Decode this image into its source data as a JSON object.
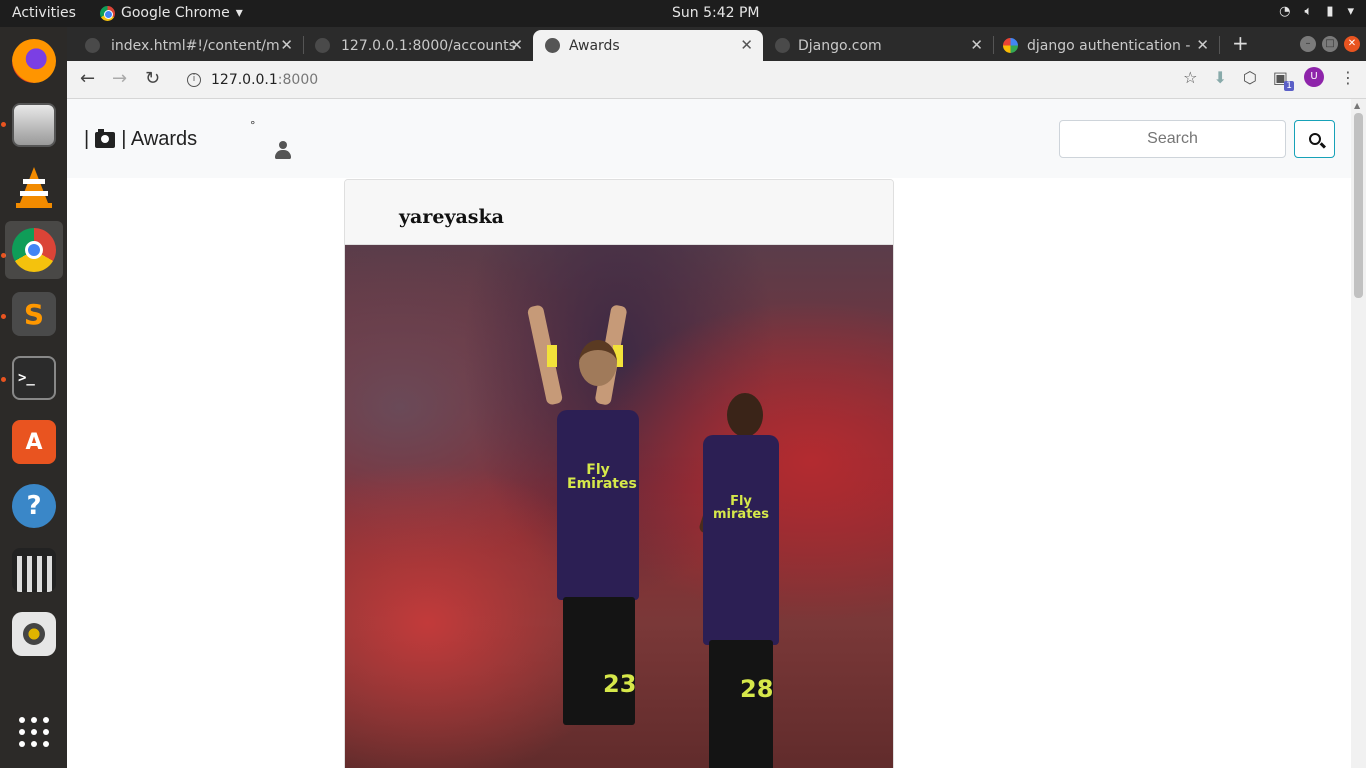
{
  "os": {
    "activities": "Activities",
    "app_name": "Google Chrome",
    "clock": "Sun  5:42 PM",
    "dock": [
      {
        "name": "firefox-icon"
      },
      {
        "name": "files-icon"
      },
      {
        "name": "vlc-icon"
      },
      {
        "name": "chrome-icon"
      },
      {
        "name": "sublime-text-icon"
      },
      {
        "name": "terminal-icon"
      },
      {
        "name": "software-center-icon"
      },
      {
        "name": "help-icon"
      },
      {
        "name": "video-editor-icon"
      },
      {
        "name": "speaker-icon"
      },
      {
        "name": "show-apps-icon"
      }
    ]
  },
  "browser": {
    "tabs": [
      {
        "title": "index.html#!/content/m",
        "active": false
      },
      {
        "title": "127.0.0.1:8000/accounts",
        "active": false
      },
      {
        "title": "Awards",
        "active": true
      },
      {
        "title": "Django.com",
        "active": false
      },
      {
        "title": "django authentication -",
        "active": false
      }
    ],
    "url_host": "127.0.0.1",
    "url_port": ":8000",
    "extension_badge": "1",
    "profile_initial": "U"
  },
  "page": {
    "brand_prefix": "|",
    "brand_text": "| Awards",
    "degree_mark": "°",
    "search_placeholder": "Search",
    "post": {
      "username": "yareyaska",
      "jersey_sponsor": "Fly\nEmirates",
      "player1_number": "23",
      "player2_number": "28"
    }
  },
  "colors": {
    "navbar_bg": "#f8f9fa",
    "search_button_border": "#17a2b8",
    "profile_avatar": "#8e24aa"
  }
}
